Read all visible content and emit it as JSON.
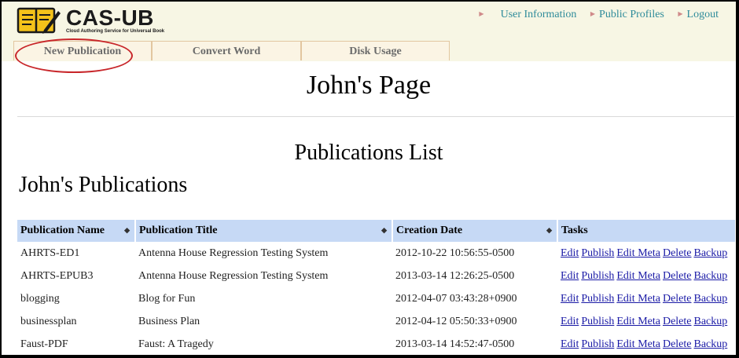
{
  "header": {
    "logo_text": "CAS-UB",
    "logo_tagline": "Cloud Authoring Service for Universal Book",
    "links": [
      "User Information",
      "Public Profiles",
      "Logout"
    ]
  },
  "nav": {
    "tabs": [
      "New Publication",
      "Convert Word",
      "Disk Usage"
    ]
  },
  "page_title": "John's Page",
  "list_title": "Publications List",
  "section_title": "John's Publications",
  "table": {
    "headers": [
      "Publication Name",
      "Publication Title",
      "Creation Date",
      "Tasks"
    ],
    "rows": [
      {
        "name": "AHRTS-ED1",
        "title": "Antenna House Regression Testing System",
        "date": "2012-10-22 10:56:55-0500"
      },
      {
        "name": "AHRTS-EPUB3",
        "title": "Antenna House Regression Testing System",
        "date": "2013-03-14 12:26:25-0500"
      },
      {
        "name": "blogging",
        "title": "Blog for Fun",
        "date": "2012-04-07 03:43:28+0900"
      },
      {
        "name": "businessplan",
        "title": "Business Plan",
        "date": "2012-04-12 05:50:33+0900"
      },
      {
        "name": "Faust-PDF",
        "title": "Faust: A Tragedy",
        "date": "2013-03-14 14:52:47-0500"
      }
    ],
    "tasks": [
      "Edit",
      "Publish",
      "Edit Meta",
      "Delete",
      "Backup"
    ]
  },
  "colors": {
    "header_bg": "#f7f6e4",
    "link": "#2e8b9a",
    "table_header_bg": "#c6d9f5",
    "annotation_circle": "#c8262a"
  }
}
